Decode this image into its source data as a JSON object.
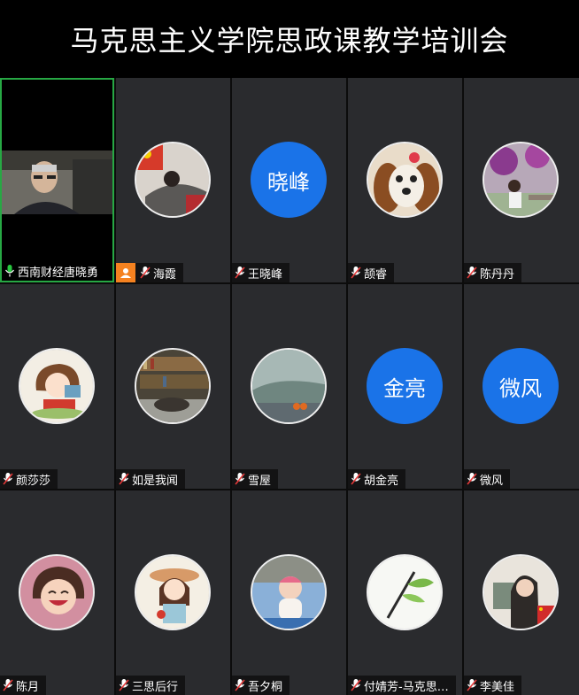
{
  "meeting": {
    "title": "马克思主义学院思政课教学培训会"
  },
  "colors": {
    "accent_blue": "#1a73e8",
    "active_border": "#27a844",
    "host_badge": "#f58220",
    "mic_red": "#e63a3a",
    "mic_green": "#28c840"
  },
  "participants": [
    {
      "name": "西南财经唐晓勇",
      "type": "video",
      "mic": "speaking-green-icon"
    },
    {
      "name": "海霞",
      "type": "photo",
      "icon": "woman-lying-photo",
      "host": true,
      "mic": "mic-muted-icon"
    },
    {
      "name": "王晓峰",
      "type": "text",
      "avatar_text": "晓峰",
      "mic": "mic-muted-icon"
    },
    {
      "name": "颉睿",
      "type": "photo",
      "icon": "dog-photo",
      "mic": "mic-muted-icon"
    },
    {
      "name": "陈丹丹",
      "type": "photo",
      "icon": "girl-flowers-photo",
      "mic": "mic-muted-icon"
    },
    {
      "name": "颜莎莎",
      "type": "photo",
      "icon": "cartoon-girl-photo",
      "mic": "mic-muted-icon"
    },
    {
      "name": "如是我闻",
      "type": "photo",
      "icon": "bookshelf-photo",
      "mic": "mic-muted-icon"
    },
    {
      "name": "雪屋",
      "type": "photo",
      "icon": "window-persimmons-photo",
      "mic": "mic-muted-icon"
    },
    {
      "name": "胡金亮",
      "type": "text",
      "avatar_text": "金亮",
      "mic": "mic-muted-icon"
    },
    {
      "name": "微风",
      "type": "text",
      "avatar_text": "微风",
      "mic": "mic-muted-icon"
    },
    {
      "name": "陈月",
      "type": "photo",
      "icon": "laughing-girl-photo",
      "mic": "mic-muted-icon"
    },
    {
      "name": "三思后行",
      "type": "photo",
      "icon": "cartoon-hat-girl-photo",
      "mic": "mic-muted-icon"
    },
    {
      "name": "吾夕桐",
      "type": "photo",
      "icon": "baby-photo",
      "mic": "mic-muted-icon"
    },
    {
      "name": "付婧芳-马克思…",
      "type": "photo",
      "icon": "bamboo-leaf-photo",
      "mic": "mic-muted-icon"
    },
    {
      "name": "李美佳",
      "type": "photo",
      "icon": "woman-flag-photo",
      "mic": "mic-muted-icon"
    }
  ]
}
